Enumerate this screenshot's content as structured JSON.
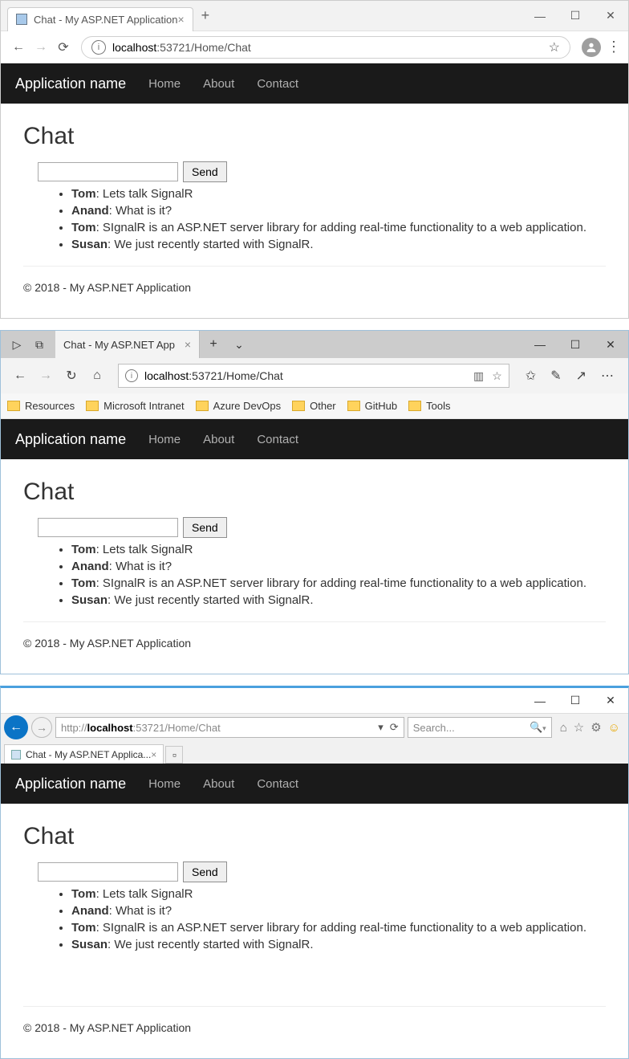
{
  "chrome": {
    "tab_title": "Chat - My ASP.NET Application",
    "url_prefix": "localhost",
    "url_suffix": ":53721/Home/Chat"
  },
  "edge": {
    "tab_title": "Chat - My ASP.NET App",
    "url_prefix": "localhost",
    "url_suffix": ":53721/Home/Chat",
    "bookmarks": [
      "Resources",
      "Microsoft Intranet",
      "Azure DevOps",
      "Other",
      "GitHub",
      "Tools"
    ]
  },
  "ie": {
    "tab_title": "Chat - My ASP.NET Applica...",
    "url_prefix": "http://",
    "url_host": "localhost",
    "url_suffix": ":53721/Home/Chat",
    "search_placeholder": "Search..."
  },
  "app": {
    "brand": "Application name",
    "nav": [
      "Home",
      "About",
      "Contact"
    ],
    "heading": "Chat",
    "send_label": "Send",
    "messages": [
      {
        "user": "Tom",
        "text": "Lets talk SignalR"
      },
      {
        "user": "Anand",
        "text": "What is it?"
      },
      {
        "user": "Tom",
        "text": "SIgnalR is an ASP.NET server library for adding real-time functionality to a web application."
      },
      {
        "user": "Susan",
        "text": "We just recently started with SignalR."
      }
    ],
    "footer": "© 2018 - My ASP.NET Application"
  }
}
